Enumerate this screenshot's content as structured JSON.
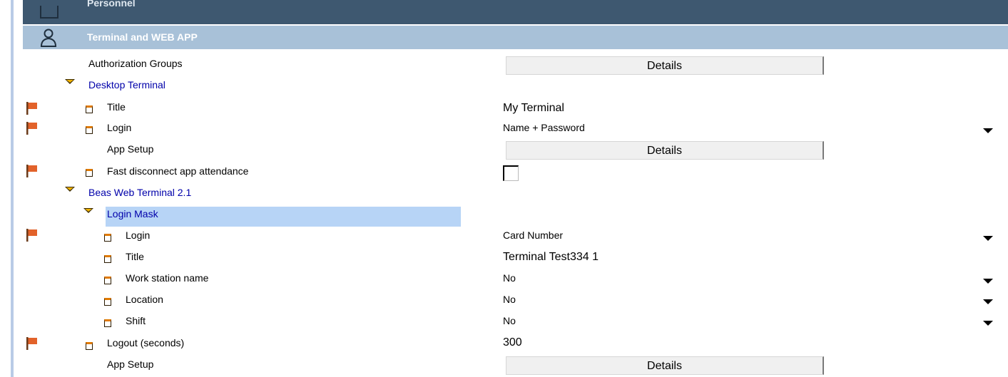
{
  "header": {
    "personnel_label": "Personnel",
    "terminal_label": "Terminal and WEB APP",
    "personnel_bg": "#3e5870",
    "terminal_bg": "#a8c1d8"
  },
  "tree": {
    "authorization_groups": "Authorization Groups",
    "desktop_terminal": "Desktop Terminal",
    "title": "Title",
    "login": "Login",
    "app_setup": "App Setup",
    "fast_disconnect": "Fast disconnect app attendance",
    "beas_web_terminal": "Beas Web Terminal 2.1",
    "login_mask": "Login Mask",
    "mask_login": "Login",
    "mask_title": "Title",
    "work_station_name": "Work station name",
    "location": "Location",
    "shift": "Shift",
    "logout_seconds": "Logout (seconds)",
    "app_setup_2": "App Setup"
  },
  "values": {
    "details": "Details",
    "desktop_title": "My Terminal",
    "desktop_login": "Name + Password",
    "fast_disconnect_checked": false,
    "mask_login": "Card Number",
    "mask_title": "Terminal Test334 1",
    "work_station_name": "No",
    "location": "No",
    "shift": "No",
    "logout_seconds": "300"
  },
  "colors": {
    "node_text": "#0000aa",
    "selection": "#b7d4f6",
    "flag": "#e2622a"
  }
}
